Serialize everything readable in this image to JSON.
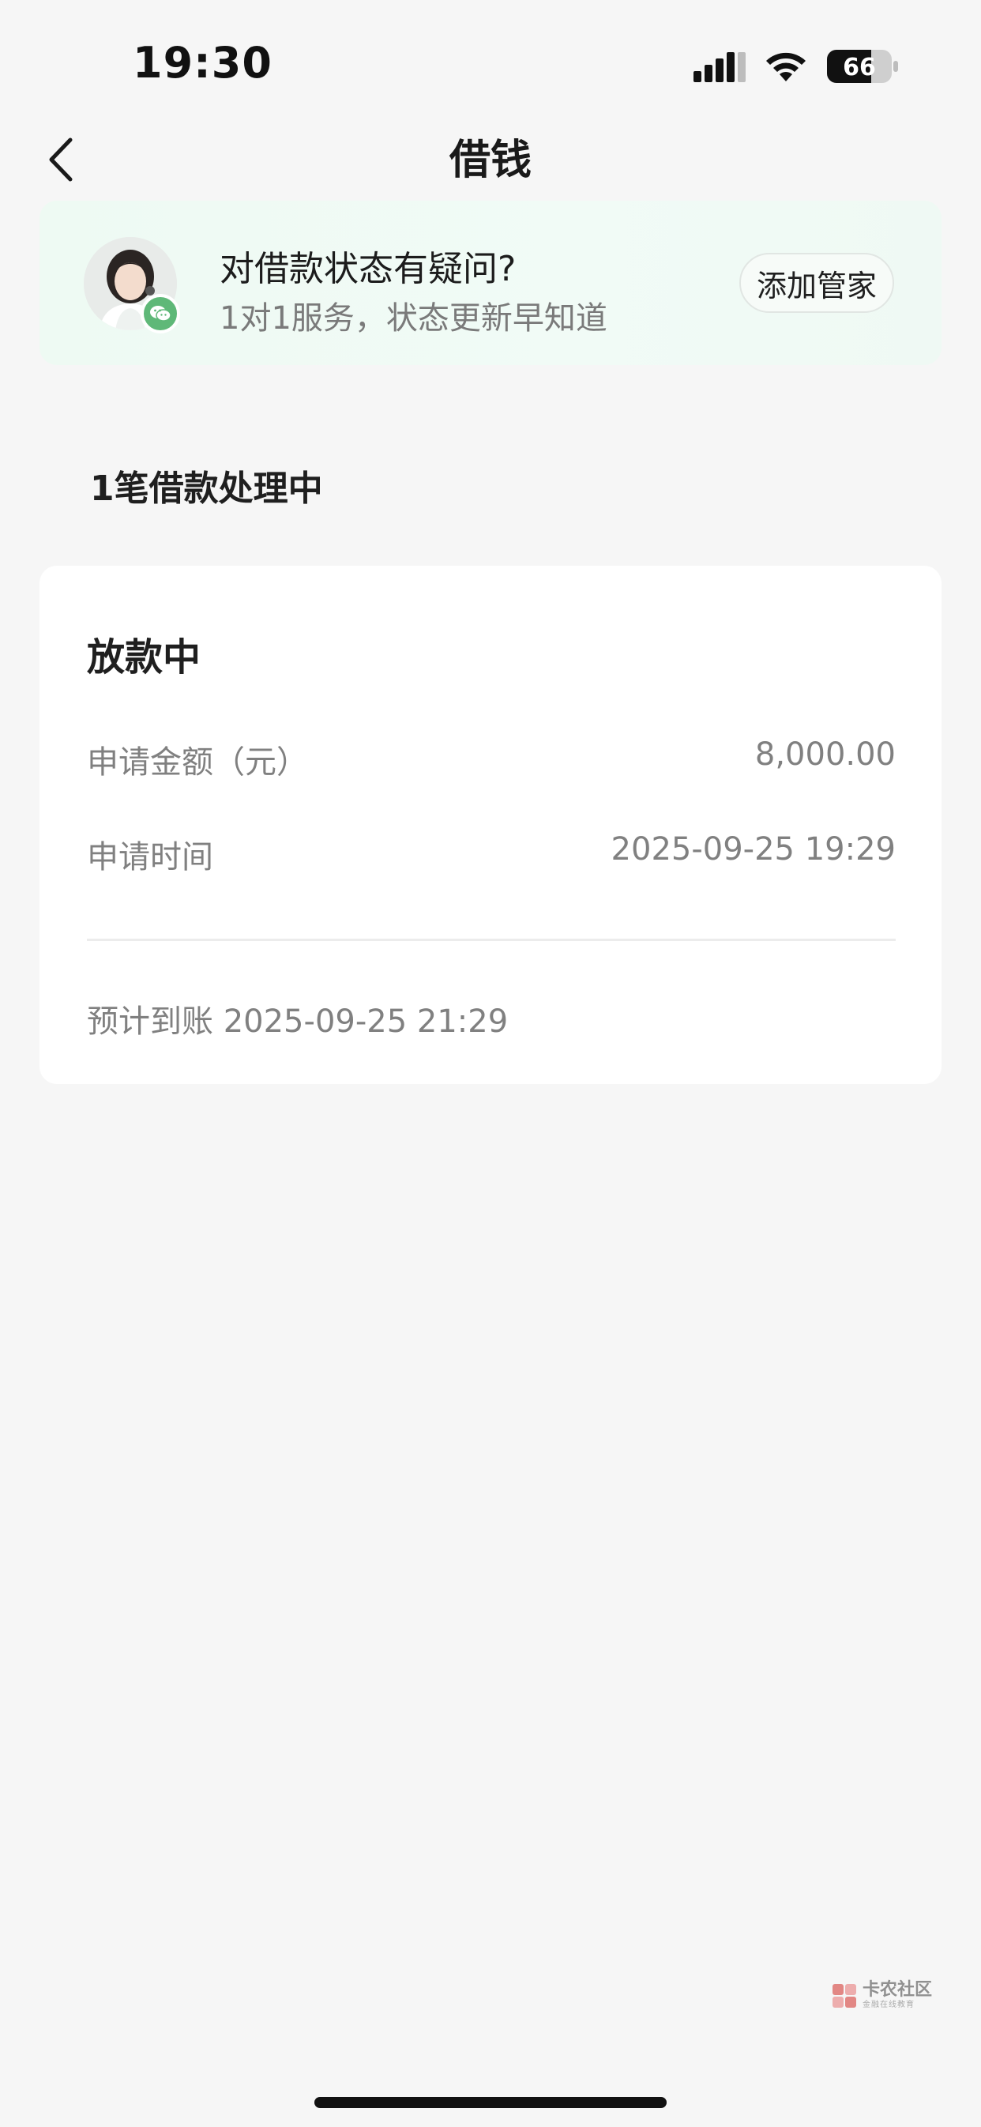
{
  "status_bar": {
    "time": "19:30",
    "battery_level": "66"
  },
  "nav": {
    "title": "借钱"
  },
  "service_banner": {
    "title": "对借款状态有疑问?",
    "subtitle": "1对1服务，状态更新早知道",
    "button_label": "添加管家"
  },
  "section": {
    "heading": "1笔借款处理中"
  },
  "loan": {
    "status": "放款中",
    "amount_label": "申请金额（元）",
    "amount_value": "8,000.00",
    "time_label": "申请时间",
    "time_value": "2025-09-25 19:29",
    "expected_arrival": "预计到账 2025-09-25 21:29"
  },
  "watermark": {
    "title": "卡农社区",
    "subtitle": "金融在线教育"
  },
  "colors": {
    "page_background": "#f6f6f6",
    "banner_background": "#eefaf3",
    "wechat_green": "#5fb878",
    "label_gray": "#808080"
  }
}
